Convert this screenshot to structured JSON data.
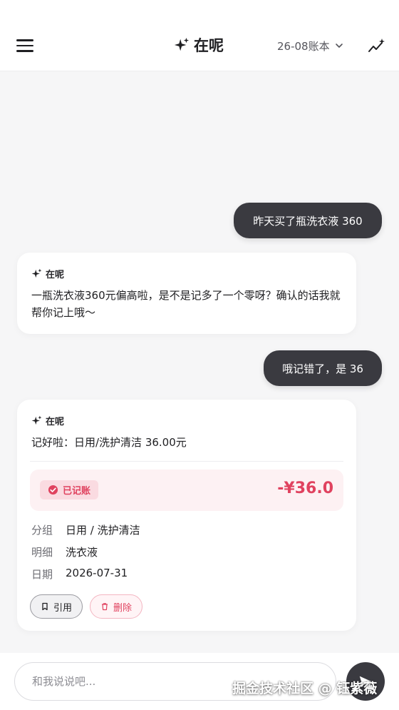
{
  "header": {
    "title": "在呢",
    "ledger_label": "26-08账本"
  },
  "messages": [
    {
      "role": "user",
      "text": "昨天买了瓶洗衣液 360"
    },
    {
      "role": "assistant",
      "name": "在呢",
      "text": "一瓶洗衣液360元偏高啦，是不是记多了一个零呀？确认的话我就帮你记上哦～"
    },
    {
      "role": "user",
      "text": "哦记错了，是 36"
    },
    {
      "role": "assistant",
      "name": "在呢",
      "text": "记好啦：日用/洗护清洁 36.00元",
      "record": {
        "status": "已记账",
        "amount": "-¥36.0",
        "fields": [
          {
            "key": "分组",
            "value": "日用 / 洗护清洁"
          },
          {
            "key": "明细",
            "value": "洗衣液"
          },
          {
            "key": "日期",
            "value": "2026-07-31"
          }
        ],
        "actions": {
          "quote": "引用",
          "delete": "删除"
        }
      }
    }
  ],
  "input": {
    "placeholder": "和我说说吧..."
  },
  "watermark": "掘金技术社区 @ 钰紫薇",
  "colors": {
    "accent": "#e0425f",
    "bubble": "#3a3a40",
    "record_bg": "#fdf1f3"
  }
}
